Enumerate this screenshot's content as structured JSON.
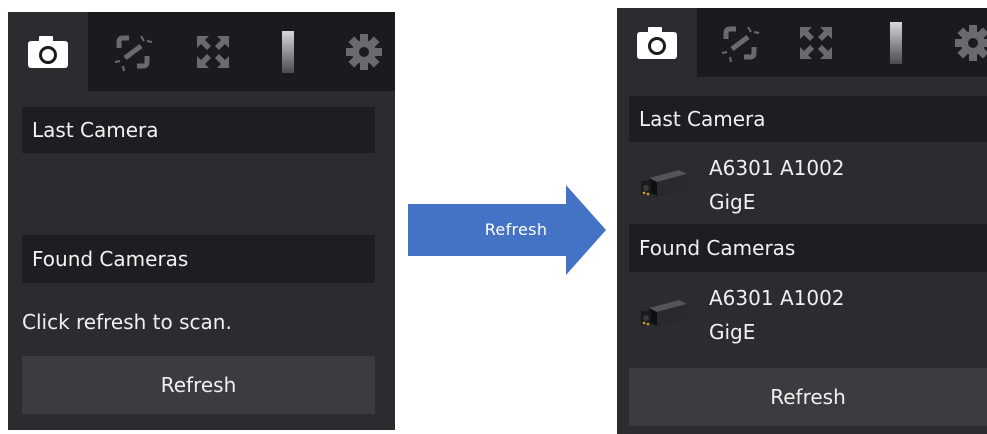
{
  "toolbar": {
    "tabs": [
      {
        "icon": "camera-icon",
        "active": true
      },
      {
        "icon": "disconnect-icon",
        "active": false
      },
      {
        "icon": "fullscreen-icon",
        "active": false
      },
      {
        "icon": "histogram-bar-icon",
        "active": false
      },
      {
        "icon": "gear-icon",
        "active": false
      }
    ]
  },
  "before": {
    "last_camera_header": "Last Camera",
    "found_cameras_header": "Found Cameras",
    "hint": "Click refresh to scan.",
    "refresh_label": "Refresh"
  },
  "transition": {
    "label": "Refresh",
    "arrow_color": "#4472c4"
  },
  "after": {
    "last_camera_header": "Last Camera",
    "last_camera": {
      "name": "A6301 A1002",
      "interface": "GigE",
      "icon": "camera-device-icon"
    },
    "found_cameras_header": "Found Cameras",
    "found_cameras": [
      {
        "name": "A6301 A1002",
        "interface": "GigE",
        "icon": "camera-device-icon"
      }
    ],
    "refresh_label": "Refresh"
  },
  "colors": {
    "panel_bg": "#2b2b30",
    "toolbar_bg": "#1b1b1f",
    "header_bg": "#1e1e22",
    "button_bg": "#3b3b40",
    "text": "#f0f0f0"
  }
}
